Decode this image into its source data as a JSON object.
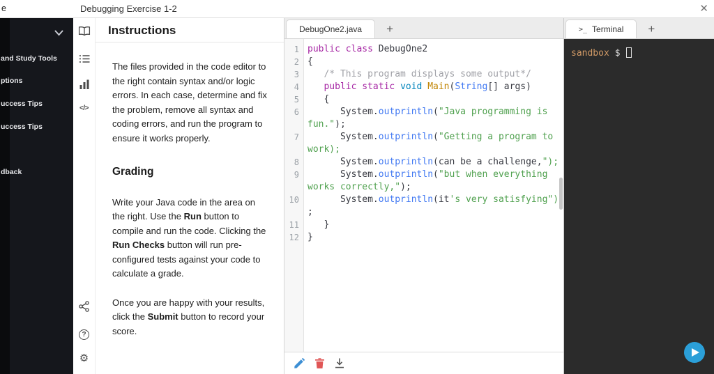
{
  "window": {
    "left_fragment": "e",
    "title": "Debugging Exercise 1-2",
    "close_glyph": "✕"
  },
  "colors": {
    "accent_blue": "#2b9fd8",
    "terminal_background": "#2b2b2b",
    "terminal_prompt_orange": "#d19a66",
    "syntax_keyword_purple": "#a626a4",
    "syntax_string_green": "#50a14f",
    "syntax_function_orange": "#c18401",
    "syntax_property_blue": "#4078f2",
    "syntax_comment_gray": "#a0a1a7"
  },
  "sidebar": {
    "items": [
      "and Study Tools",
      "ptions",
      "uccess Tips",
      "uccess Tips",
      "dback"
    ]
  },
  "rail": {
    "icons": [
      "open-book-icon",
      "checklist-icon",
      "bar-chart-icon",
      "code-icon",
      "share-icon",
      "help-icon",
      "gear-icon"
    ],
    "code_glyph": "</>",
    "help_glyph": "?",
    "gear_glyph": "⚙"
  },
  "instructions": {
    "title": "Instructions",
    "intro": "The files provided in the code editor to the right contain syntax and/or logic errors. In each case, determine and fix the problem, remove all syntax and coding errors, and run the program to ensure it works properly.",
    "grading_title": "Grading",
    "grading_parts": [
      "Write your Java code in the area on the right. Use the ",
      "Run",
      " button to compile and run the code. Clicking the ",
      "Run Checks",
      " button will run pre-configured tests against your code to calculate a grade."
    ],
    "submit_parts": [
      "Once you are happy with your results, click the ",
      "Submit",
      " button to record your score."
    ]
  },
  "editor": {
    "tab_label": "DebugOne2.java",
    "new_tab_glyph": "+",
    "rows": [
      {
        "n": "1",
        "seg": [
          [
            "kw",
            "public class"
          ],
          [
            "pl",
            " DebugOne2"
          ]
        ]
      },
      {
        "n": "2",
        "seg": [
          [
            "pl",
            "{"
          ]
        ]
      },
      {
        "n": "3",
        "seg": [
          [
            "pl",
            "   "
          ],
          [
            "cm",
            "/* This program displays some output*/"
          ]
        ]
      },
      {
        "n": "4",
        "seg": [
          [
            "pl",
            "   "
          ],
          [
            "kw",
            "public static"
          ],
          [
            "pl",
            " "
          ],
          [
            "ty",
            "void"
          ],
          [
            "pl",
            " "
          ],
          [
            "fn",
            "Main"
          ],
          [
            "pl",
            "("
          ],
          [
            "cl",
            "String"
          ],
          [
            "pl",
            "[] args)"
          ]
        ]
      },
      {
        "n": "5",
        "seg": [
          [
            "pl",
            "   {"
          ]
        ]
      },
      {
        "n": "6",
        "seg": [
          [
            "pl",
            "      System."
          ],
          [
            "pr",
            "outprintln"
          ],
          [
            "pl",
            "("
          ],
          [
            "st",
            "\"Java programming is"
          ]
        ]
      },
      {
        "n": "",
        "seg": [
          [
            "st",
            "fun.\""
          ],
          [
            "pl",
            ");"
          ]
        ]
      },
      {
        "n": "7",
        "seg": [
          [
            "pl",
            "      System."
          ],
          [
            "pr",
            "outprintln"
          ],
          [
            "pl",
            "("
          ],
          [
            "st",
            "\"Getting a program to"
          ]
        ]
      },
      {
        "n": "",
        "seg": [
          [
            "st",
            "work);"
          ]
        ]
      },
      {
        "n": "8",
        "seg": [
          [
            "pl",
            "      System."
          ],
          [
            "pr",
            "outprintln"
          ],
          [
            "pl",
            "(can be a challenge,"
          ],
          [
            "st",
            "\");"
          ]
        ]
      },
      {
        "n": "9",
        "seg": [
          [
            "pl",
            "      System."
          ],
          [
            "pr",
            "outprintln"
          ],
          [
            "pl",
            "("
          ],
          [
            "st",
            "\"but when everything"
          ]
        ]
      },
      {
        "n": "",
        "seg": [
          [
            "st",
            "works correctly,\""
          ],
          [
            "pl",
            ");"
          ]
        ]
      },
      {
        "n": "10",
        "seg": [
          [
            "pl",
            "      System."
          ],
          [
            "pr",
            "outprintln"
          ],
          [
            "pl",
            "(it"
          ],
          [
            "st",
            "'s very satisfying\")"
          ]
        ]
      },
      {
        "n": "",
        "seg": [
          [
            "pl",
            ";"
          ]
        ]
      },
      {
        "n": "11",
        "seg": [
          [
            "pl",
            "   }"
          ]
        ]
      },
      {
        "n": "12",
        "seg": [
          [
            "pl",
            "}"
          ]
        ]
      }
    ]
  },
  "terminal": {
    "tab_icon": ">_",
    "tab_label": "Terminal",
    "new_tab_glyph": "+",
    "prompt_user": "sandbox",
    "prompt_symbol": "$"
  }
}
